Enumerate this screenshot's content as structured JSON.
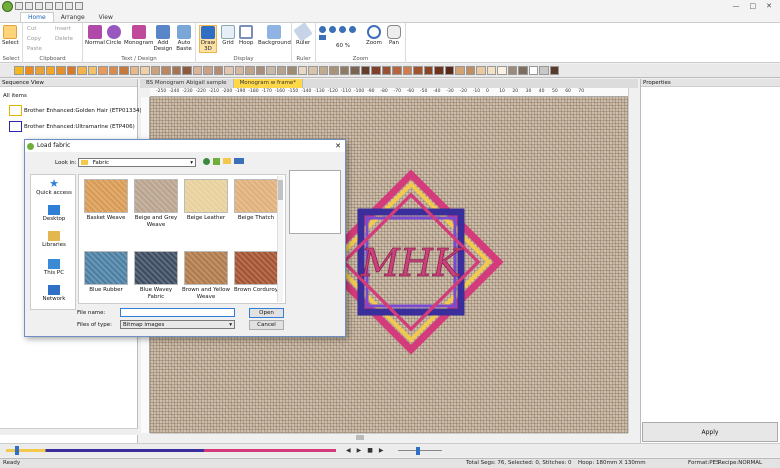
{
  "ribbon_tabs": [
    "Home",
    "Arrange",
    "View"
  ],
  "groups": {
    "select": "Select",
    "clipboard": "Clipboard",
    "text_design": "Text / Design",
    "display": "Display",
    "ruler": "Ruler",
    "zoom": "Zoom"
  },
  "buttons": {
    "select": "Select",
    "cut": "Cut",
    "copy": "Copy",
    "paste": "Paste",
    "insert": "Insert",
    "delete": "Delete",
    "normal": "Normal",
    "circle": "Circle",
    "monogram": "Monogram",
    "add_design": "Add Design",
    "auto_baste": "Auto Baste",
    "draw3d": "Draw 3D",
    "grid": "Grid",
    "hoop": "Hoop",
    "background": "Background",
    "ruler": "Ruler",
    "zoom_pct": "60 %",
    "zoom": "Zoom",
    "pan": "Pan"
  },
  "palette": [
    "#f7b81d",
    "#f08a1c",
    "#e9a13a",
    "#f5a623",
    "#e7902b",
    "#d97a2a",
    "#f2b24c",
    "#f3c16b",
    "#e89a5a",
    "#d98b4d",
    "#c47a3f",
    "#e6b98a",
    "#f0d0a8",
    "#caa27d",
    "#b88863",
    "#a57455",
    "#8c5a3c",
    "#d9b49a",
    "#c9a088",
    "#b48b74",
    "#e3c6b1",
    "#d4b8a0",
    "#bfa48c",
    "#a98f79",
    "#c8b9a6",
    "#b5a38d",
    "#9f8c75",
    "#e8d8c1",
    "#d6c3a8",
    "#c0ab8f",
    "#a8927a",
    "#8f7a65",
    "#7a6552",
    "#653d2a",
    "#7f3f2a",
    "#9a4e32",
    "#b5643e",
    "#cf7d4f",
    "#a0552f",
    "#8a4426",
    "#6f321c",
    "#5a2718",
    "#d4a373",
    "#bf8f62",
    "#e8c9a1",
    "#f4e2c5",
    "#fbf1e0",
    "#9c8b7a",
    "#7d6e60",
    "#ffffff",
    "#c8c8c8",
    "#5a3a2a"
  ],
  "sequence": {
    "title": "Sequence View",
    "all_items": "All items",
    "items": [
      {
        "label": "Brother Enhanced:Golden Hair (ETP01334)",
        "color": "#e5b400"
      },
      {
        "label": "Brother Enhanced:Ultramarine (ETP406)",
        "color": "#2a2aa8"
      }
    ]
  },
  "doc_tabs": [
    "BS Monogram Abigail sample",
    "Monogram w frame*"
  ],
  "ruler_ticks": [
    "-250",
    "-240",
    "-230",
    "-220",
    "-210",
    "-200",
    "-190",
    "-180",
    "-170",
    "-160",
    "-150",
    "-140",
    "-130",
    "-120",
    "-110",
    "-100",
    "-90",
    "-80",
    "-70",
    "-60",
    "-50",
    "-40",
    "-30",
    "-20",
    "-10",
    "0",
    "10",
    "20",
    "30",
    "40",
    "50",
    "60",
    "70"
  ],
  "monogram": "MHK",
  "dialog": {
    "title": "Load fabric",
    "look_in_label": "Look in:",
    "look_in_value": "Fabric",
    "places": [
      "Quick access",
      "Desktop",
      "Libraries",
      "This PC",
      "Network"
    ],
    "files": [
      {
        "name": "Basket Weave",
        "color": "#d89a52"
      },
      {
        "name": "Beige and Grey Weave",
        "color": "#b9a38e"
      },
      {
        "name": "Beige Leather",
        "color": "#e8d09a"
      },
      {
        "name": "Beige Thatch",
        "color": "#e0b07a"
      },
      {
        "name": "Blue Rubber",
        "color": "#4a7fa3"
      },
      {
        "name": "Blue Wavey Fabric",
        "color": "#3c4c60"
      },
      {
        "name": "Brown and Yellow Weave",
        "color": "#b07a4a"
      },
      {
        "name": "Brown Corduroy",
        "color": "#a4522f"
      }
    ],
    "file_name_label": "File name:",
    "file_name_value": "",
    "files_type_label": "Files of type:",
    "files_type_value": "Bitmap images",
    "open": "Open",
    "cancel": "Cancel"
  },
  "properties": {
    "title": "Properties",
    "apply": "Apply"
  },
  "status": {
    "ready": "Ready",
    "stitch_info": "Total Segs: 76, Selected: 0, Stitches: 0",
    "hoop": "Hoop: 180mm X 130mm",
    "format": "Format:PES",
    "recipe": "Recipe:NORMAL"
  }
}
